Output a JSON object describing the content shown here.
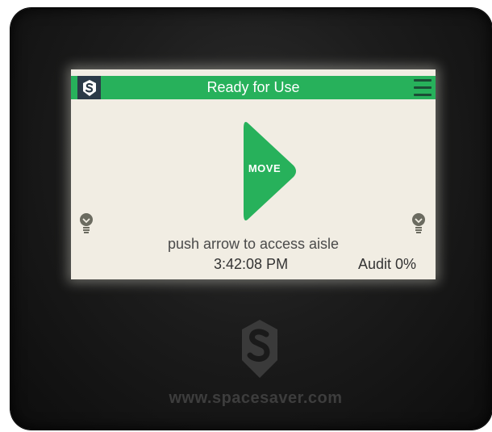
{
  "header": {
    "title": "Ready for Use"
  },
  "move_button": {
    "label": "MOVE"
  },
  "hint": "push arrow to access aisle",
  "clock": "3:42:08 PM",
  "audit": "Audit 0%",
  "footer_url": "www.spacesaver.com",
  "icons": {
    "logo": "spacesaver-logo-icon",
    "menu": "hamburger-menu-icon",
    "light": "light-bulb-icon"
  },
  "colors": {
    "accent": "#27b15b",
    "screen_bg": "#f1ede3",
    "logo_box": "#2b3a47",
    "bezel": "#1c1c1c"
  }
}
